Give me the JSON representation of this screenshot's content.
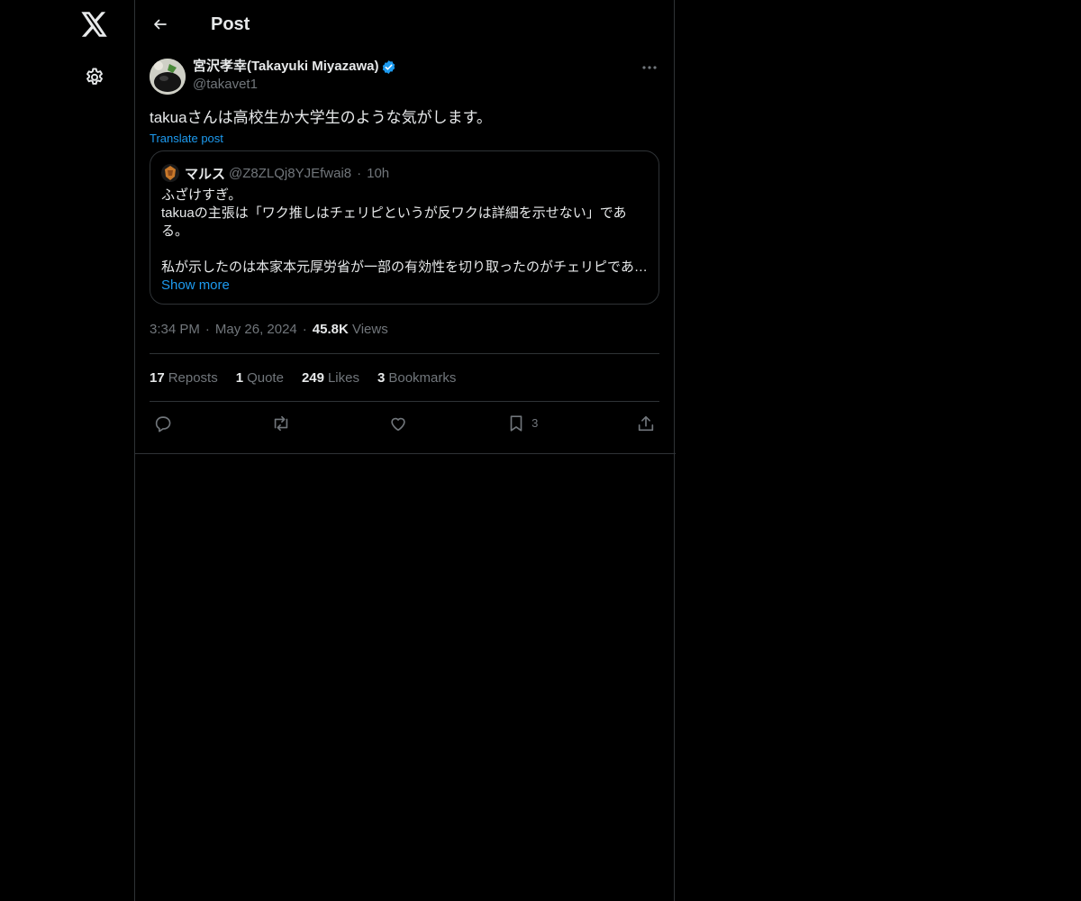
{
  "nav": {
    "logo_icon": "x-logo-icon",
    "settings_icon": "gear-icon"
  },
  "header": {
    "title": "Post",
    "back_icon": "arrow-left-icon"
  },
  "post": {
    "author": {
      "display_name": "宮沢孝幸(Takayuki Miyazawa)",
      "handle": "@takavet1",
      "verified": true
    },
    "text": "takuaさんは高校生か大学生のような気がします。",
    "translate_label": "Translate post",
    "quote": {
      "display_name": "マルス",
      "handle": "@Z8ZLQj8YJEfwai8",
      "dot": "·",
      "time": "10h",
      "lines": [
        "ふざけすぎ。",
        "takuaの主張は「ワク推しはチェリピというが反ワクは詳細を示せない」である。",
        "",
        "私が示したのは本家本元厚労省が一部の有効性を切り取ったのがチェリピであ…"
      ],
      "show_more": "Show more"
    },
    "meta": {
      "time": "3:34 PM",
      "date": "May 26, 2024",
      "views_count": "45.8K",
      "views_label": "Views",
      "sep": "·"
    },
    "stats": {
      "reposts_count": "17",
      "reposts_label": "Reposts",
      "quotes_count": "1",
      "quotes_label": "Quote",
      "likes_count": "249",
      "likes_label": "Likes",
      "bookmarks_count": "3",
      "bookmarks_label": "Bookmarks"
    },
    "actions": {
      "bookmark_count": "3"
    }
  },
  "colors": {
    "background": "#000000",
    "text": "#e7e9ea",
    "muted": "#71767b",
    "accent": "#1d9bf0",
    "border": "#2f3336"
  }
}
